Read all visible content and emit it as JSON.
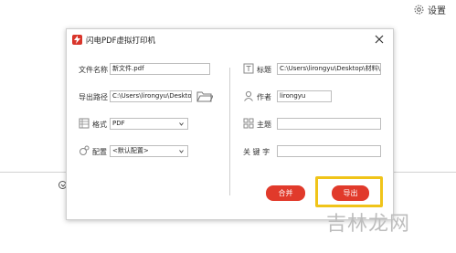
{
  "background": {
    "settings_label": "设置"
  },
  "dialog": {
    "title": "闪电PDF虚拟打印机",
    "left": {
      "filename_label": "文件名称",
      "filename_value": "新文件.pdf",
      "export_path_label": "导出路径",
      "export_path_value": "C:\\Users\\lirongyu\\Desktop",
      "format_label": "格式",
      "format_value": "PDF",
      "config_label": "配置",
      "config_value": "<默认配置>"
    },
    "right": {
      "title_label": "标题",
      "title_value": "C:\\Users\\lirongyu\\Desktop\\材料\\PDF合",
      "author_label": "作者",
      "author_value": "lirongyu",
      "subject_label": "主题",
      "subject_value": "",
      "keywords_label": "关 键 字",
      "keywords_value": ""
    },
    "merge_button": "合并",
    "export_button": "导出"
  },
  "watermark": "吉林龙网",
  "colors": {
    "accent": "#e13a2b",
    "highlight": "#f0c419"
  }
}
